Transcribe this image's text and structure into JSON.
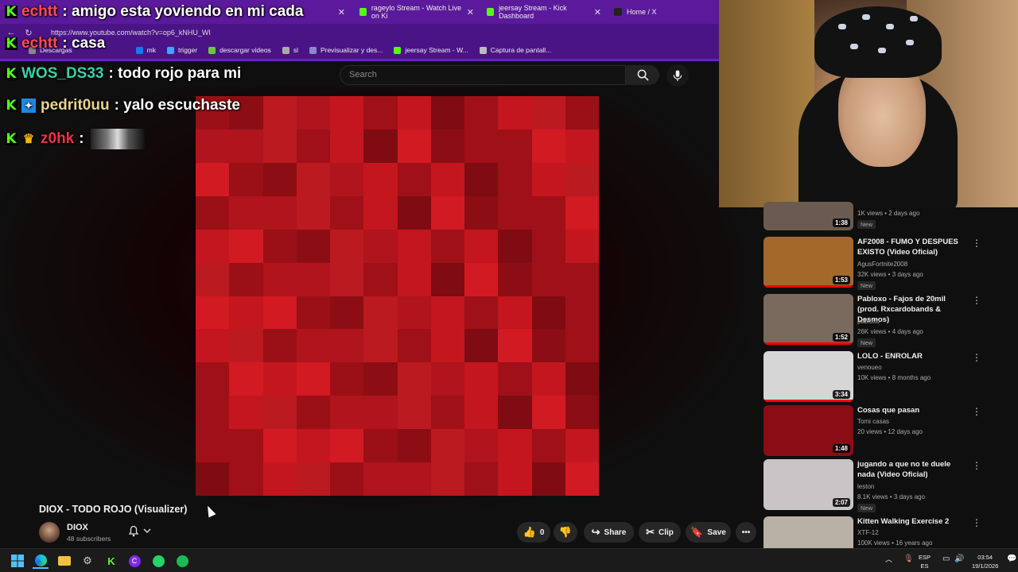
{
  "browser": {
    "tabs": [
      {
        "label": "rageylo Stream - Watch Live on Ki"
      },
      {
        "label": "jeersay Stream - Kick Dashboard"
      },
      {
        "label": "Home / X"
      }
    ],
    "close_glyph": "✕",
    "url": "https://www.youtube.com/watch?v=op6_kNHU_WI",
    "bookmarks": [
      "Descargas",
      "mk",
      "trigger",
      "descargar videos",
      "sl",
      "Previsualizar y des...",
      "jeersay Stream - W...",
      "Captura de pantall..."
    ]
  },
  "youtube": {
    "search_placeholder": "Search",
    "video": {
      "title": "DIOX - TODO ROJO (Visualizer)",
      "channel": "DIOX",
      "subscribers": "48 subscribers",
      "likes": "0",
      "share_label": "Share",
      "clip_label": "Clip",
      "save_label": "Save"
    },
    "recommendations": [
      {
        "title": "",
        "channel": "",
        "meta": "1K views • 2 days ago",
        "duration": "1:38",
        "badge": "New",
        "thumb": "#6a5a50"
      },
      {
        "title": "AF2008 - FUMO Y DESPUES EXISTO (Video Oficial)",
        "channel": "AgusFortnite2008",
        "meta": "32K views • 3 days ago",
        "duration": "1:53",
        "badge": "New",
        "thumb": "#a4682b"
      },
      {
        "title": "Pabloxo - Fajos de 20mil (prod. Rxcardobands & Desmos)",
        "channel": "pabloxo",
        "meta": "26K views • 4 days ago",
        "duration": "1:52",
        "badge": "New",
        "thumb": "#7a6a5e"
      },
      {
        "title": "LOLO - ENROLAR",
        "channel": "venoueo",
        "meta": "10K views • 8 months ago",
        "duration": "3:34",
        "badge": "",
        "thumb": "#d6d6d6"
      },
      {
        "title": "Cosas que pasan",
        "channel": "Tomi casas",
        "meta": "20 views • 12 days ago",
        "duration": "1:48",
        "badge": "",
        "thumb": "#8a0c14"
      },
      {
        "title": "jugando a que no te duele nada (Video Oficial)",
        "channel": "leston",
        "meta": "8.1K views • 3 days ago",
        "duration": "2:07",
        "badge": "New",
        "thumb": "#c9c4c6"
      },
      {
        "title": "Kitten Walking Exercise 2",
        "channel": "XTF-12",
        "meta": "100K views • 16 years ago",
        "duration": "",
        "badge": "",
        "thumb": "#b9b1a6"
      }
    ]
  },
  "chat": [
    {
      "user": "echtt",
      "message": ": amigo esta yoviendo en mi cada",
      "user_color": "#ff4d4d",
      "badge": ""
    },
    {
      "user": "echtt",
      "message": ": casa",
      "user_color": "#ff4d4d",
      "badge": ""
    },
    {
      "user": "WOS_DS33",
      "message": ": todo rojo para mi",
      "user_color": "#3ccfa8",
      "badge": ""
    },
    {
      "user": "pedrit0uu",
      "message": ": yalo escuchaste",
      "user_color": "#e8d38a",
      "badge": "verified"
    },
    {
      "user": "z0hk",
      "message": ":",
      "user_color": "#e8344a",
      "badge": "crown"
    }
  ],
  "taskbar": {
    "lang_top": "ESP",
    "lang_bottom": "ES",
    "time": "03:54",
    "date": "19/1/2026"
  },
  "colors": {
    "kick_green": "#53fc18",
    "browser_purple": "#5b1a9c",
    "youtube_bg": "#0f0f0f"
  }
}
